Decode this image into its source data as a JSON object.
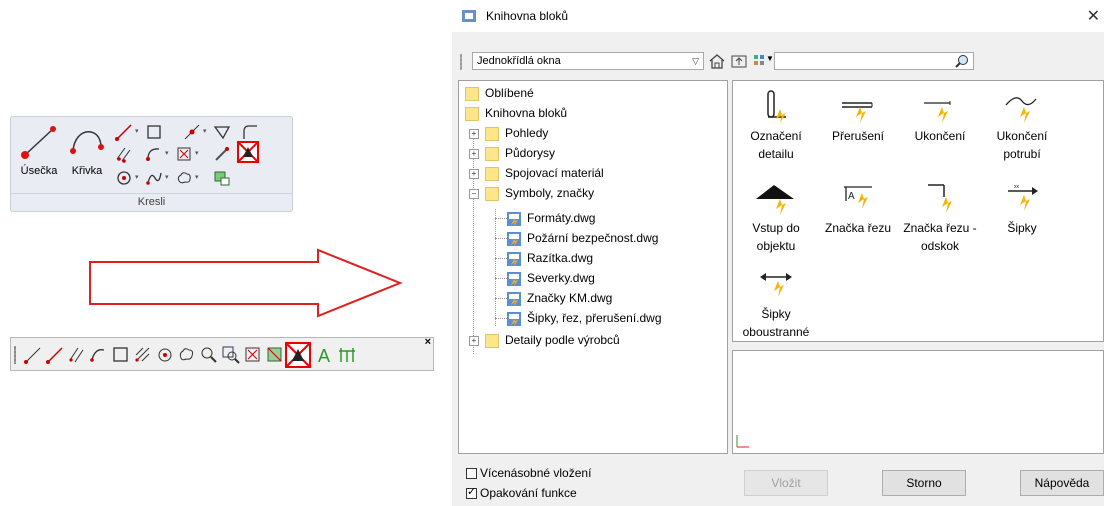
{
  "ribbon": {
    "line_label": "Úsečka",
    "curve_label": "Křivka",
    "group_label": "Kresli"
  },
  "dialog": {
    "title": "Knihovna bloků",
    "category_selected": "Jednokřídlá okna",
    "search_value": "",
    "tree": [
      {
        "label": "Oblíbené"
      },
      {
        "label": "Knihovna bloků"
      },
      {
        "label": "Pohledy"
      },
      {
        "label": "Půdorysy"
      },
      {
        "label": "Spojovací materiál"
      },
      {
        "label": "Symboly, značky"
      },
      {
        "label": "Formáty.dwg"
      },
      {
        "label": "Požární bezpečnost.dwg"
      },
      {
        "label": "Razítka.dwg"
      },
      {
        "label": "Severky.dwg"
      },
      {
        "label": "Značky KM.dwg"
      },
      {
        "label": "Šipky, řez, přerušení.dwg"
      },
      {
        "label": "Detaily podle výrobců"
      }
    ],
    "blocks": [
      {
        "line1": "Označení",
        "line2": "detailu"
      },
      {
        "line1": "Přerušení",
        "line2": ""
      },
      {
        "line1": "Ukončení",
        "line2": ""
      },
      {
        "line1": "Ukončení",
        "line2": "potrubí"
      },
      {
        "line1": "Vstup do",
        "line2": "objektu"
      },
      {
        "line1": "Značka řezu",
        "line2": ""
      },
      {
        "line1": "Značka řezu -",
        "line2": "odskok"
      },
      {
        "line1": "Šipky",
        "line2": ""
      },
      {
        "line1": "Šipky",
        "line2": "oboustranné"
      }
    ],
    "multi_insert_label": "Vícenásobné vložení",
    "repeat_label": "Opakování funkce",
    "insert_button": "Vložit",
    "cancel_button": "Storno",
    "help_button": "Nápověda"
  }
}
